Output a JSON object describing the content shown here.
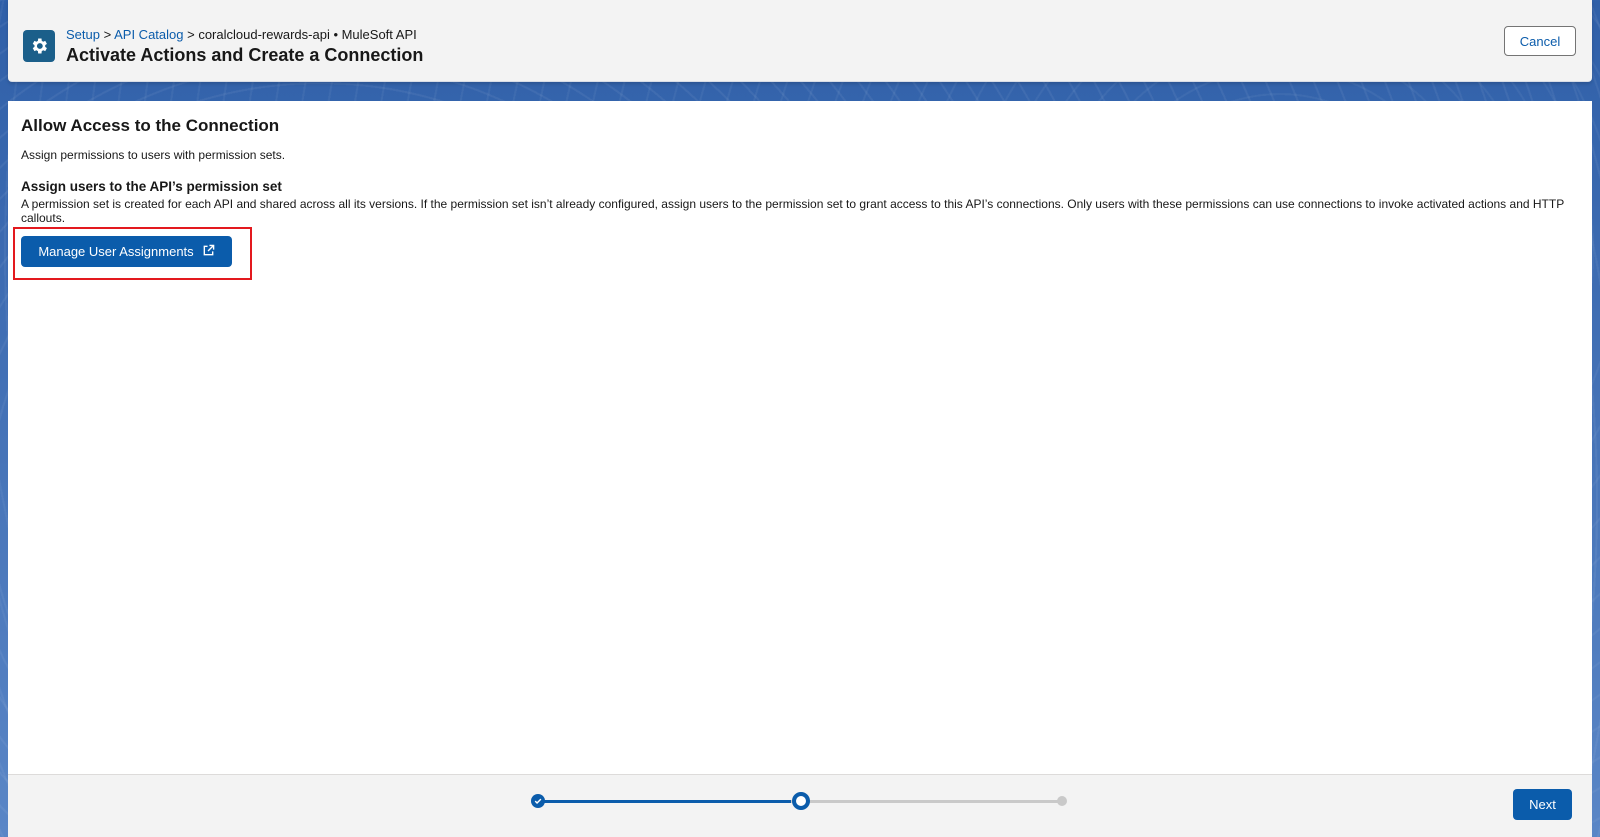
{
  "header": {
    "breadcrumb": {
      "items": [
        {
          "label": "Setup",
          "link": true
        },
        {
          "label": "API Catalog",
          "link": true
        },
        {
          "label": "coralcloud-rewards-api • MuleSoft API",
          "link": false
        }
      ],
      "separator": ">"
    },
    "title": "Activate Actions and Create a Connection",
    "cancel_label": "Cancel",
    "icon": "gear-icon"
  },
  "main": {
    "section_title": "Allow Access to the Connection",
    "section_description": "Assign permissions to users with permission sets.",
    "subsection_title": "Assign users to the API’s permission set",
    "subsection_description": "A permission set is created for each API and shared across all its versions. If the permission set isn’t already configured, assign users to the permission set to grant access to this API’s connections. Only users with these permissions can use connections to invoke activated actions and HTTP callouts.",
    "manage_button_label": "Manage User Assignments",
    "manage_button_icon": "external-link-icon"
  },
  "footer": {
    "progress": {
      "steps": [
        "complete",
        "active",
        "upcoming"
      ],
      "current_step": 2,
      "total_steps": 3
    },
    "next_label": "Next"
  },
  "colors": {
    "brand": "#0b5cab",
    "highlight": "#e3191e",
    "header_icon_bg": "#1b5f8a"
  }
}
